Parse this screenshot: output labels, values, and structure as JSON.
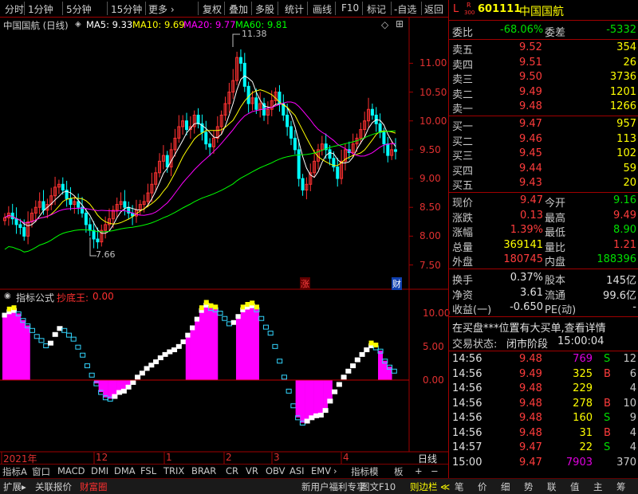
{
  "toolbar": {
    "left": [
      "分时",
      "1分钟",
      "5分钟",
      "15分钟",
      "更多 ›"
    ],
    "right": [
      "复权",
      "叠加",
      "多股",
      "统计",
      "画线",
      "F10",
      "标记",
      "-自选",
      "返回"
    ]
  },
  "stock": {
    "prefix": "L",
    "sub_top": "R",
    "sub_bot": "300",
    "code": "601111",
    "name": "中国国航"
  },
  "chart": {
    "title": "中国国航 (日线)",
    "ma5": "MA5: 9.33",
    "ma10": "MA10: 9.69",
    "ma20": "MA20: 9.77",
    "ma60": "MA60: 9.81",
    "ma5_color": "#ffffff",
    "ma10_color": "#ffff00",
    "ma20_color": "#ff00ff",
    "ma60_color": "#00ff00",
    "high_label": "11.38",
    "low_label": "7.66",
    "zhang": "涨",
    "cai": "财",
    "price_ticks": [
      "11.00",
      "10.50",
      "10.00",
      "9.50",
      "9.00",
      "8.50",
      "8.00",
      "7.50"
    ],
    "ind_name": "指标公式",
    "ind_title": "抄底王:",
    "ind_value": "0.00",
    "ind_ticks": [
      "10.00",
      "5.00",
      "0.00"
    ],
    "x_labels": [
      "2021年",
      "12",
      "1",
      "2",
      "3",
      "4"
    ],
    "period": "日线"
  },
  "chart_data": [
    {
      "type": "candlestick",
      "ylim": [
        7.3,
        11.6
      ],
      "closes": [
        8.32,
        8.4,
        8.3,
        8.2,
        8.15,
        8.0,
        8.25,
        8.4,
        8.5,
        8.6,
        8.45,
        8.55,
        8.7,
        8.85,
        8.9,
        8.8,
        8.65,
        8.55,
        8.6,
        8.5,
        8.4,
        8.2,
        8.1,
        7.95,
        7.9,
        8.1,
        8.2,
        8.3,
        8.45,
        8.55,
        8.6,
        8.5,
        8.4,
        8.35,
        8.45,
        8.55,
        8.6,
        8.75,
        8.9,
        9.1,
        9.3,
        9.4,
        9.2,
        9.5,
        9.7,
        9.9,
        10.0,
        9.85,
        9.9,
        10.1,
        9.95,
        9.8,
        9.6,
        9.55,
        9.7,
        9.9,
        10.1,
        10.3,
        10.5,
        10.7,
        11.1,
        11.0,
        10.6,
        10.3,
        10.4,
        10.2,
        10.3,
        10.1,
        10.2,
        10.35,
        10.5,
        10.3,
        10.1,
        9.9,
        9.7,
        9.5,
        9.0,
        8.8,
        8.9,
        9.1,
        9.3,
        9.5,
        9.6,
        9.5,
        9.35,
        9.2,
        9.0,
        9.3,
        9.5,
        9.45,
        9.6,
        9.7,
        9.85,
        10.0,
        10.2,
        10.1,
        9.95,
        9.8,
        9.6,
        9.4,
        9.5,
        9.47
      ]
    },
    {
      "type": "bar",
      "name": "抄底王",
      "ylim": [
        -8.5,
        12.5
      ],
      "values": [
        9.8,
        10.3,
        10.5,
        10.0,
        9.0,
        8.2,
        7.5,
        6.6,
        6.0,
        5.2,
        5.6,
        6.9,
        7.8,
        7.5,
        6.8,
        6.2,
        5.0,
        3.8,
        2.2,
        0.8,
        -0.5,
        -1.8,
        -2.6,
        -2.8,
        -2.4,
        -1.8,
        -1.6,
        -1.0,
        -0.3,
        0.5,
        1.1,
        1.8,
        2.3,
        2.8,
        3.4,
        3.9,
        4.3,
        4.6,
        5.1,
        5.8,
        6.8,
        7.9,
        9.2,
        10.5,
        11.3,
        10.8,
        10.6,
        10.1,
        9.3,
        8.5,
        8.7,
        9.6,
        10.6,
        11.0,
        11.2,
        10.6,
        9.3,
        8.0,
        7.1,
        5.1,
        2.9,
        0.5,
        -1.6,
        -3.8,
        -5.6,
        -6.4,
        -6.1,
        -5.6,
        -5.3,
        -5.2,
        -4.5,
        -3.1,
        -1.7,
        -0.6,
        0.5,
        1.4,
        2.2,
        3.1,
        3.9,
        4.6,
        5.2,
        4.9,
        4.4,
        2.9,
        2.0,
        1.4
      ]
    }
  ],
  "quote": {
    "weibi_lbl": "委比",
    "weibi": "-68.06%",
    "weicha_lbl": "委差",
    "weicha": "-5332",
    "sells": [
      {
        "l": "卖五",
        "p": "9.52",
        "v": "354"
      },
      {
        "l": "卖四",
        "p": "9.51",
        "v": "26"
      },
      {
        "l": "卖三",
        "p": "9.50",
        "v": "3736"
      },
      {
        "l": "卖二",
        "p": "9.49",
        "v": "1201"
      },
      {
        "l": "卖一",
        "p": "9.48",
        "v": "1266"
      }
    ],
    "buys": [
      {
        "l": "买一",
        "p": "9.47",
        "v": "957"
      },
      {
        "l": "买二",
        "p": "9.46",
        "v": "113"
      },
      {
        "l": "买三",
        "p": "9.45",
        "v": "102"
      },
      {
        "l": "买四",
        "p": "9.44",
        "v": "59"
      },
      {
        "l": "买五",
        "p": "9.43",
        "v": "20"
      }
    ],
    "stats": [
      {
        "l1": "现价",
        "v1": "9.47",
        "c1": "red",
        "l2": "今开",
        "v2": "9.16",
        "c2": "grn"
      },
      {
        "l1": "涨跌",
        "v1": "0.13",
        "c1": "red",
        "l2": "最高",
        "v2": "9.49",
        "c2": "red"
      },
      {
        "l1": "涨幅",
        "v1": "1.39%",
        "c1": "red",
        "l2": "最低",
        "v2": "8.90",
        "c2": "grn"
      },
      {
        "l1": "总量",
        "v1": "369141",
        "c1": "yel",
        "l2": "量比",
        "v2": "1.21",
        "c2": "red"
      },
      {
        "l1": "外盘",
        "v1": "180745",
        "c1": "red",
        "l2": "内盘",
        "v2": "188396",
        "c2": "grn"
      }
    ],
    "fund": [
      {
        "l1": "换手",
        "v1": "0.37%",
        "l2": "股本",
        "v2": "145亿"
      },
      {
        "l1": "净资",
        "v1": "3.61",
        "l2": "流通",
        "v2": "99.6亿"
      },
      {
        "l1": "收益(一)",
        "v1": "-0.650",
        "l2": "PE(动)",
        "v2": "-"
      }
    ],
    "notice": "在买盘***位置有大买单,查看详情",
    "status_lbl": "交易状态:",
    "status": "闭市阶段",
    "status_time": "15:00:04",
    "ticks": [
      {
        "t": "14:56",
        "p": "9.48",
        "v": "769",
        "d": "S",
        "n": "12",
        "vc": "mag",
        "dc": "grn"
      },
      {
        "t": "14:56",
        "p": "9.49",
        "v": "325",
        "d": "B",
        "n": "6",
        "vc": "yel",
        "dc": "red"
      },
      {
        "t": "14:56",
        "p": "9.48",
        "v": "229",
        "d": "",
        "n": "4",
        "vc": "yel",
        "dc": "wht"
      },
      {
        "t": "14:56",
        "p": "9.48",
        "v": "278",
        "d": "B",
        "n": "10",
        "vc": "yel",
        "dc": "red"
      },
      {
        "t": "14:56",
        "p": "9.48",
        "v": "160",
        "d": "S",
        "n": "9",
        "vc": "yel",
        "dc": "grn"
      },
      {
        "t": "14:56",
        "p": "9.48",
        "v": "31",
        "d": "B",
        "n": "4",
        "vc": "yel",
        "dc": "red"
      },
      {
        "t": "14:57",
        "p": "9.47",
        "v": "22",
        "d": "S",
        "n": "4",
        "vc": "yel",
        "dc": "grn"
      },
      {
        "t": "15:00",
        "p": "9.47",
        "v": "7903",
        "d": "",
        "n": "370",
        "vc": "mag",
        "dc": "wht"
      }
    ]
  },
  "tabs": [
    "指标A",
    "窗口",
    "MACD",
    "DMI",
    "DMA",
    "FSL",
    "TRIX",
    "BRAR",
    "CR",
    "VR",
    "OBV",
    "ASI",
    "EMV",
    "›",
    "指标模",
    "板",
    "+",
    "−"
  ],
  "bottom": {
    "left": [
      "扩展▸",
      "关联报价",
      "财富圈"
    ],
    "mid": [
      "新用户福利专享",
      "图文F10",
      "则边栏 ≪"
    ],
    "right": [
      "笔",
      "价",
      "细",
      "势",
      "联",
      "值",
      "主",
      "筹"
    ]
  }
}
